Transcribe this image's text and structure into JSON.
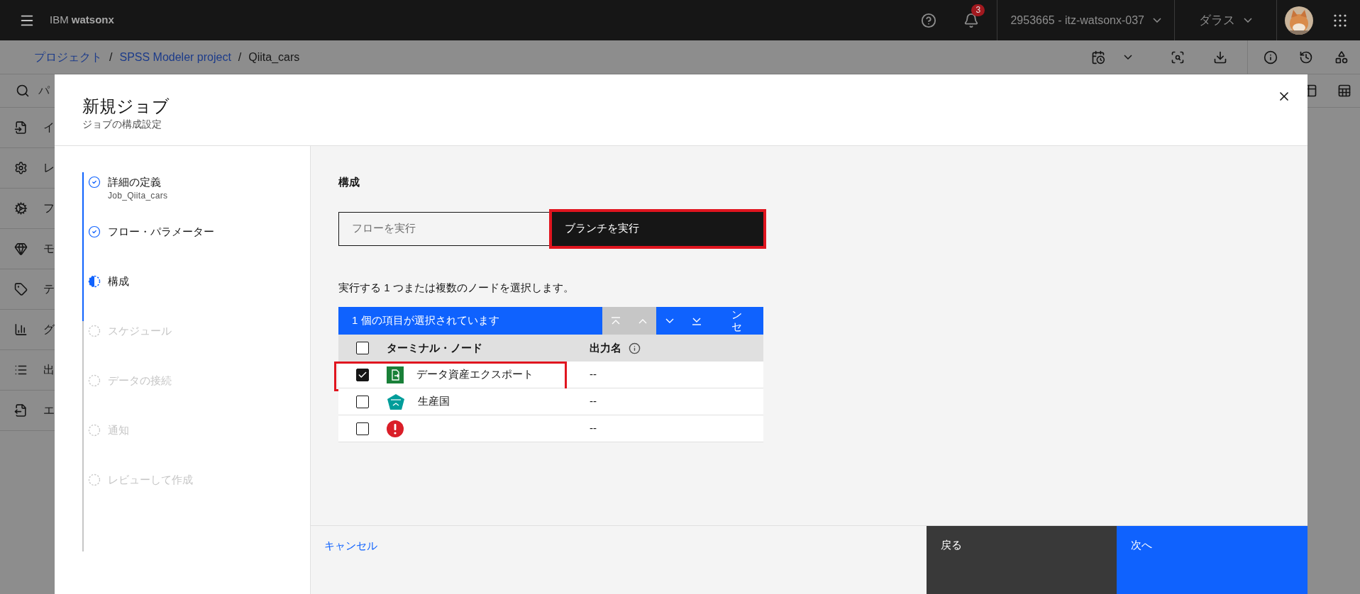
{
  "header": {
    "brand_prefix": "IBM",
    "brand_name": "watsonx",
    "notification_count": "3",
    "account": "2953665 - itz-watsonx-037",
    "region": "ダラス"
  },
  "breadcrumb": [
    {
      "label": "プロジェクト",
      "link": true
    },
    {
      "separator": "/",
      "label": "SPSS Modeler project",
      "link": true
    },
    {
      "separator": "/",
      "label": "Qiita_cars",
      "link": false
    }
  ],
  "search": {
    "placeholder": "パ"
  },
  "sidebar": {
    "items": [
      {
        "kind": "import",
        "label": "イ"
      },
      {
        "kind": "record",
        "label": "レ"
      },
      {
        "kind": "field",
        "label": "フ"
      },
      {
        "kind": "model",
        "label": "モ"
      },
      {
        "kind": "text",
        "label": "テ"
      },
      {
        "kind": "graph",
        "label": "グ"
      },
      {
        "kind": "output",
        "label": "出"
      },
      {
        "kind": "export",
        "label": "エ"
      }
    ]
  },
  "dialog": {
    "title": "新規ジョブ",
    "subtitle": "ジョブの構成設定",
    "steps": [
      {
        "label": "詳細の定義",
        "detail": "Job_Qiita_cars",
        "kind": "complete"
      },
      {
        "label": "フロー・パラメーター",
        "kind": "complete"
      },
      {
        "label": "構成",
        "kind": "current"
      },
      {
        "label": "スケジュール",
        "kind": "incomplete"
      },
      {
        "label": "データの接続",
        "kind": "incomplete"
      },
      {
        "label": "通知",
        "kind": "incomplete"
      },
      {
        "label": "レビューして作成",
        "kind": "incomplete"
      }
    ],
    "section_title": "構成",
    "run_modes": [
      {
        "label": "フローを実行",
        "selected": false,
        "highlighted": false
      },
      {
        "label": "ブランチを実行",
        "selected": true,
        "highlighted": true
      }
    ],
    "instruction": "実行する 1 つまたは複数のノードを選択します。",
    "table": {
      "batch_bar": {
        "text": "1 個の項目が選択されています",
        "actions": [
          {
            "kind": "to-top",
            "disabled": true
          },
          {
            "kind": "up",
            "disabled": true
          },
          {
            "kind": "down",
            "disabled": false
          },
          {
            "kind": "to-bottom",
            "disabled": false
          }
        ],
        "overflow_text": "ンセ"
      },
      "header_checked": false,
      "columns": [
        {
          "label": "ターミナル・ノード",
          "info": false
        },
        {
          "label": "出力名",
          "info": true
        }
      ],
      "rows": [
        {
          "checked": true,
          "kind": "export",
          "name": "データ資産エクスポート",
          "output": "--",
          "highlighted": true
        },
        {
          "checked": false,
          "kind": "chart",
          "name": "生産国",
          "output": "--",
          "highlighted": false
        },
        {
          "checked": false,
          "kind": "error",
          "output": "--",
          "highlighted": false
        }
      ]
    }
  },
  "footer": {
    "cancel": "キャンセル",
    "back": "戻る",
    "next": "次へ"
  }
}
